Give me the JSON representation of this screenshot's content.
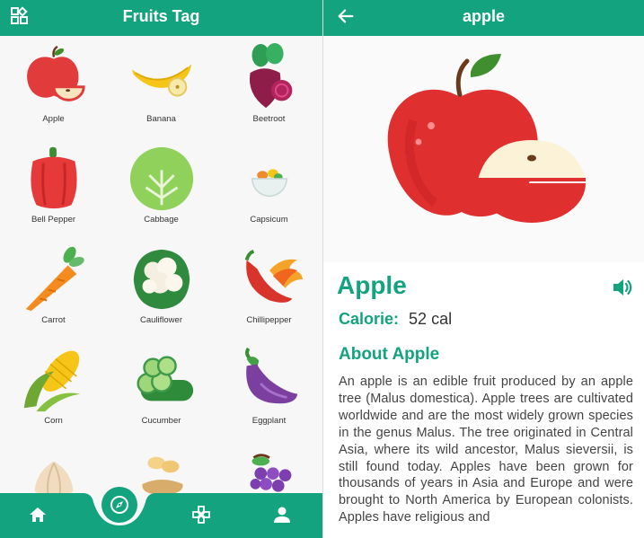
{
  "list_screen": {
    "title": "Fruits Tag",
    "lead_icon": "grid-view-icon",
    "items": [
      {
        "label": "Apple",
        "icon": "apple-icon"
      },
      {
        "label": "Banana",
        "icon": "banana-icon"
      },
      {
        "label": "Beetroot",
        "icon": "beetroot-icon"
      },
      {
        "label": "Bell Pepper",
        "icon": "bell-pepper-icon"
      },
      {
        "label": "Cabbage",
        "icon": "cabbage-icon"
      },
      {
        "label": "Capsicum",
        "icon": "capsicum-icon"
      },
      {
        "label": "Carrot",
        "icon": "carrot-icon"
      },
      {
        "label": "Cauliflower",
        "icon": "cauliflower-icon"
      },
      {
        "label": "Chillipepper",
        "icon": "chilli-pepper-icon"
      },
      {
        "label": "Corn",
        "icon": "corn-icon"
      },
      {
        "label": "Cucumber",
        "icon": "cucumber-icon"
      },
      {
        "label": "Eggplant",
        "icon": "eggplant-icon"
      },
      {
        "label": "",
        "icon": "garlic-icon"
      },
      {
        "label": "",
        "icon": "ginger-icon"
      },
      {
        "label": "",
        "icon": "grapes-icon"
      }
    ],
    "bottom_nav": [
      "home-icon",
      "compass-icon",
      "gamepad-icon",
      "person-icon"
    ]
  },
  "detail_screen": {
    "title": "apple",
    "back_icon": "arrow-left-icon",
    "name": "Apple",
    "calorie_label": "Calorie:",
    "calorie_value": "52 cal",
    "about_title": "About Apple",
    "about_text": "An apple is an edible fruit produced by an apple tree (Malus domestica). Apple trees are cultivated worldwide and are the most widely grown species in the genus Malus. The tree originated in Central Asia, where its wild ancestor, Malus sieversii, is still found today. Apples have been grown for thousands of years in Asia and Europe and were brought to North America by European colonists. Apples have religious and"
  },
  "colors": {
    "primary": "#14a37f",
    "background": "#f7f7f7",
    "text": "#333333"
  }
}
